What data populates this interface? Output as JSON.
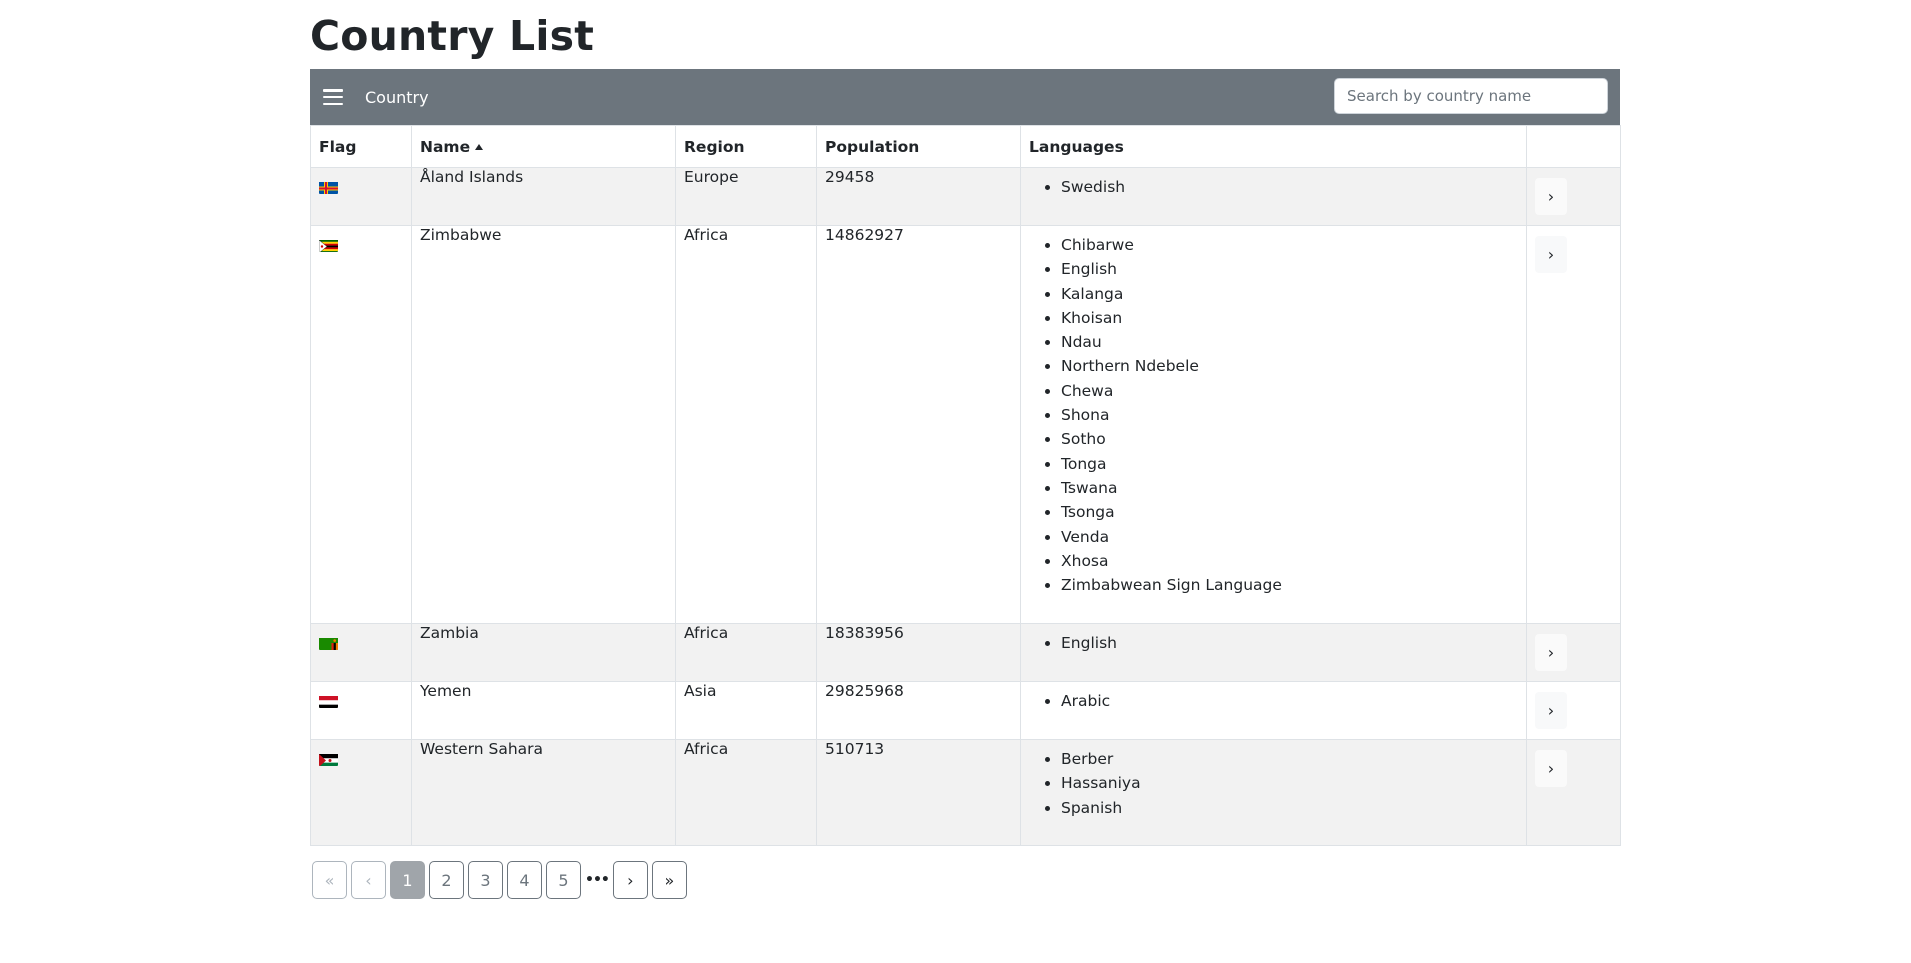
{
  "page": {
    "title": "Country List"
  },
  "navbar": {
    "brand": "Country",
    "search_placeholder": "Search by country name",
    "search_value": ""
  },
  "table": {
    "columns": {
      "flag": "Flag",
      "name": "Name",
      "region": "Region",
      "population": "Population",
      "languages": "Languages"
    },
    "sort": {
      "column": "name",
      "direction": "ascending"
    },
    "rows": [
      {
        "flag_icon": "aland-islands-flag-icon",
        "name": "Åland Islands",
        "region": "Europe",
        "population": "29458",
        "languages": [
          "Swedish"
        ]
      },
      {
        "flag_icon": "zimbabwe-flag-icon",
        "name": "Zimbabwe",
        "region": "Africa",
        "population": "14862927",
        "languages": [
          "Chibarwe",
          "English",
          "Kalanga",
          "Khoisan",
          "Ndau",
          "Northern Ndebele",
          "Chewa",
          "Shona",
          "Sotho",
          "Tonga",
          "Tswana",
          "Tsonga",
          "Venda",
          "Xhosa",
          "Zimbabwean Sign Language"
        ]
      },
      {
        "flag_icon": "zambia-flag-icon",
        "name": "Zambia",
        "region": "Africa",
        "population": "18383956",
        "languages": [
          "English"
        ]
      },
      {
        "flag_icon": "yemen-flag-icon",
        "name": "Yemen",
        "region": "Asia",
        "population": "29825968",
        "languages": [
          "Arabic"
        ]
      },
      {
        "flag_icon": "western-sahara-flag-icon",
        "name": "Western Sahara",
        "region": "Africa",
        "population": "510713",
        "languages": [
          "Berber",
          "Hassaniya",
          "Spanish"
        ]
      }
    ],
    "expand_label": "›"
  },
  "pagination": {
    "first": "«",
    "prev": "‹",
    "pages": [
      "1",
      "2",
      "3",
      "4",
      "5"
    ],
    "active_page": "1",
    "ellipsis": "•••",
    "next": "›",
    "last": "»"
  },
  "colors": {
    "navbar": "#6c757d",
    "striped_row": "#f2f2f2",
    "active_page": "#a0a5aa"
  }
}
